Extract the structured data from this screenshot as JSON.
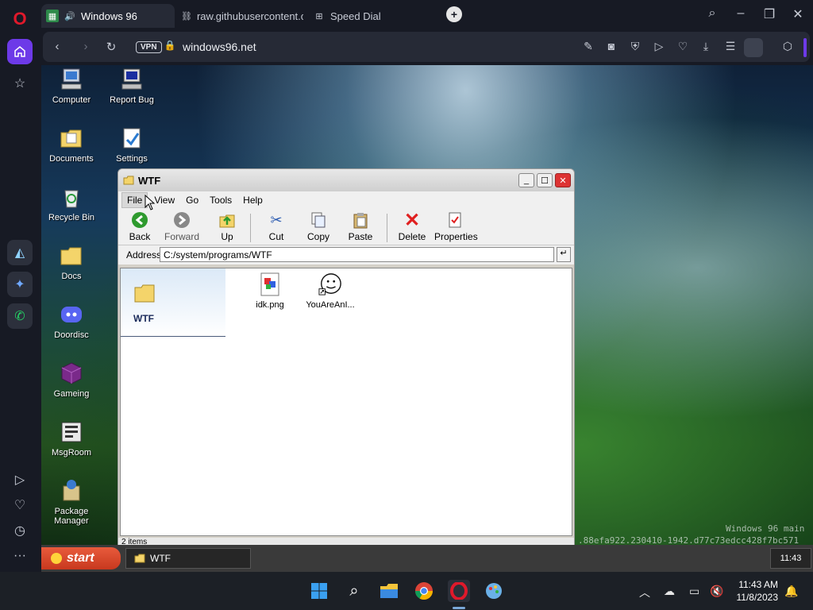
{
  "browser": {
    "tabs": [
      {
        "label": "Windows 96",
        "active": true
      },
      {
        "label": "raw.githubusercontent.com",
        "active": false
      },
      {
        "label": "Speed Dial",
        "active": false
      }
    ],
    "vpn_label": "VPN",
    "url": "windows96.net"
  },
  "desktop": {
    "icons": [
      {
        "label": "Computer"
      },
      {
        "label": "Report Bug"
      },
      {
        "label": "Documents"
      },
      {
        "label": "Settings"
      },
      {
        "label": "Recycle Bin"
      },
      {
        "label": "Docs"
      },
      {
        "label": "Doordisc"
      },
      {
        "label": "Gameing"
      },
      {
        "label": "MsgRoom"
      },
      {
        "label": "Package Manager"
      }
    ],
    "watermark_line1": "Windows 96 main",
    "watermark_line2": ".88efa922.230410-1942.d77c73edcc428f7bc571"
  },
  "explorer": {
    "title": "WTF",
    "menu": [
      "File",
      "View",
      "Go",
      "Tools",
      "Help"
    ],
    "toolbar": {
      "back": "Back",
      "forward": "Forward",
      "up": "Up",
      "cut": "Cut",
      "copy": "Copy",
      "paste": "Paste",
      "delete": "Delete",
      "properties": "Properties"
    },
    "address_label": "Address",
    "address_value": "C:/system/programs/WTF",
    "folder_name": "WTF",
    "files": [
      {
        "name": "idk.png"
      },
      {
        "name": "YouAreAnI..."
      }
    ],
    "status": "2 items"
  },
  "w96_taskbar": {
    "start_label": "start",
    "task_label": "WTF",
    "clock": "11:43"
  },
  "os_taskbar": {
    "time": "11:43 AM",
    "date": "11/8/2023"
  }
}
